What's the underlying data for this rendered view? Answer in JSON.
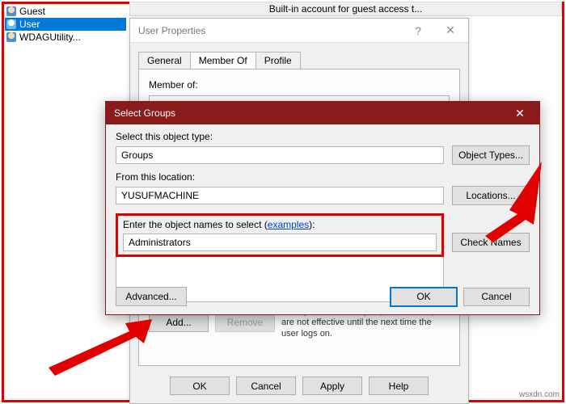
{
  "desc_bar": "Built-in account for guest access t...",
  "tree": {
    "items": [
      {
        "label": "Guest",
        "selected": false
      },
      {
        "label": "User",
        "selected": true
      },
      {
        "label": "WDAGUtility...",
        "selected": false
      }
    ]
  },
  "dlg1": {
    "title": "User Properties",
    "tabs": {
      "general": "General",
      "member_of": "Member Of",
      "profile": "Profile",
      "active": "member_of"
    },
    "member_of_label": "Member of:",
    "add": "Add...",
    "remove": "Remove",
    "note": "Changes to a user's group membership are not effective until the next time the user logs on.",
    "buttons": {
      "ok": "OK",
      "cancel": "Cancel",
      "apply": "Apply",
      "help": "Help"
    }
  },
  "dlg2": {
    "title": "Select Groups",
    "close_icon": "✕",
    "select_type_label": "Select this object type:",
    "object_type_value": "Groups",
    "object_types_btn": "Object Types...",
    "from_location_label": "From this location:",
    "location_value": "YUSUFMACHINE",
    "locations_btn": "Locations...",
    "enter_label_pre": "Enter the object names to select (",
    "examples_link": "examples",
    "enter_label_post": "):",
    "entered_value": "Administrators",
    "check_names_btn": "Check Names",
    "advanced_btn": "Advanced...",
    "ok": "OK",
    "cancel": "Cancel"
  },
  "watermark": "wsxdn.com"
}
